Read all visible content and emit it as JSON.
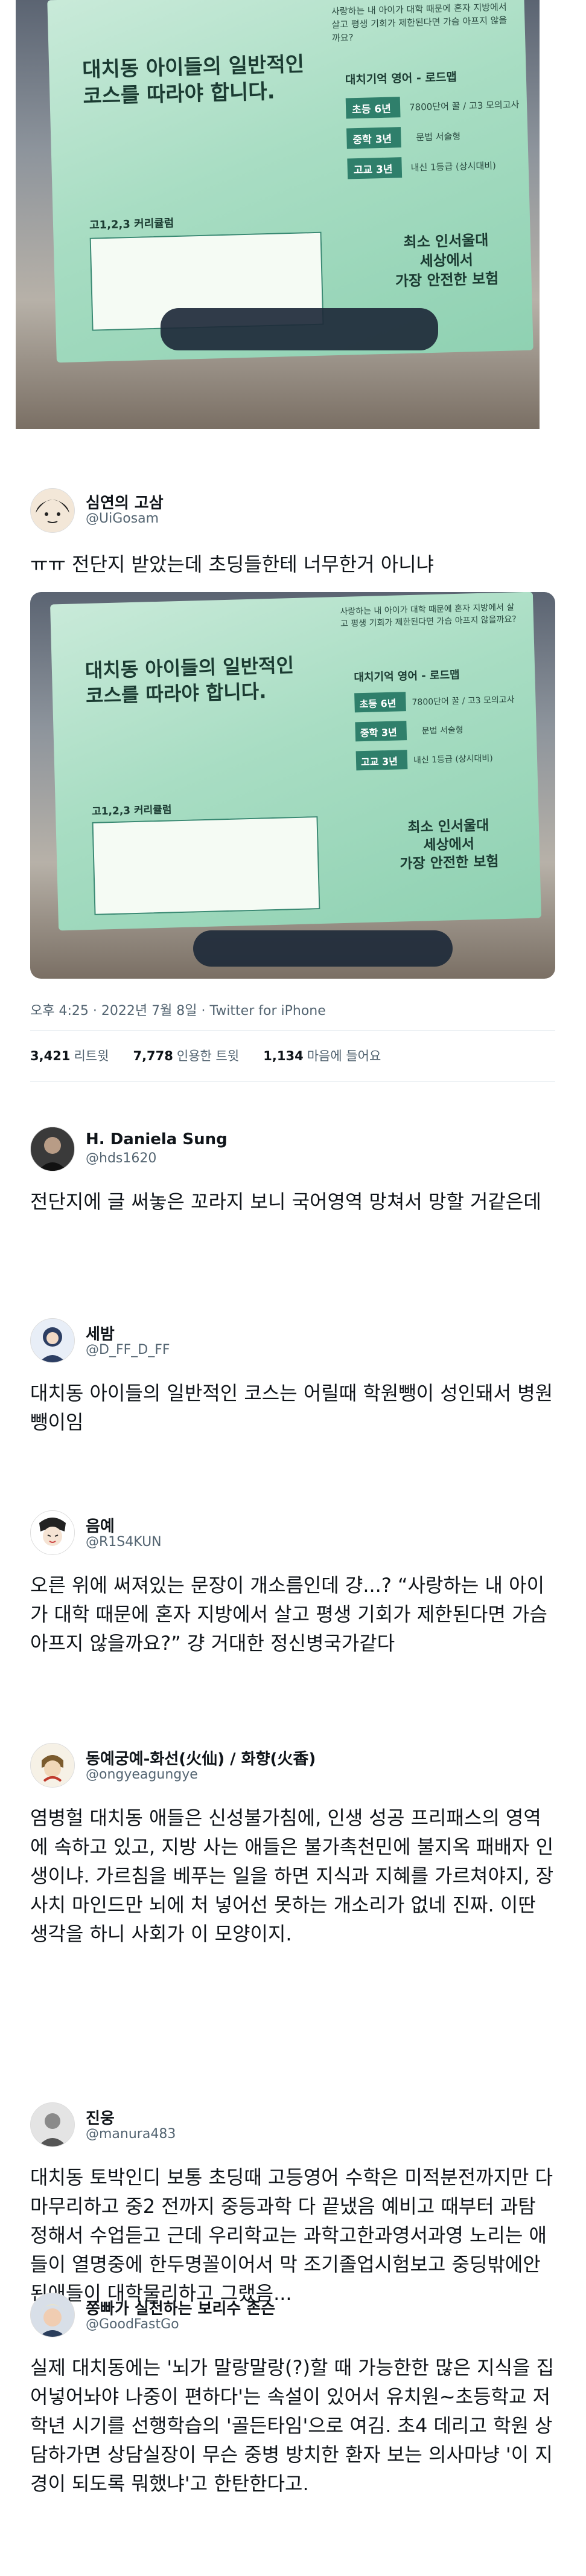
{
  "flyer": {
    "heading": "대치동 아이들의 일반적인\n코스를 따라야 합니다.",
    "roadmap_title": "대치기억 영어 - 로드맵",
    "rows": [
      "초등 6년",
      "중학 3년",
      "고교 3년"
    ],
    "row_values": [
      "7800단어 꿀 / 고3 모의고사",
      "문법 서술형",
      "내신 1등급 (상시대비)"
    ],
    "curriculum_title": "고1,2,3 커리큘럼",
    "slogan": "최소 인서울대\n세상에서\n가장 안전한 보험",
    "top_caption": "사랑하는 내 아이가 대학 때문에 혼자 지방에서 살고 평생 기회가 제한된다면 가슴 아프지 않을까요?"
  },
  "quoted": {
    "name": "심연의 고삼",
    "handle": "@UiGosam",
    "text": "ㅠㅠ 전단지 받았는데 초딩들한테 너무한거 아니냐",
    "time": "오후 4:25 · 2022년 7월 8일 · Twitter for iPhone",
    "retweets_n": "3,421",
    "retweets_l": "리트윗",
    "quotes_n": "7,778",
    "quotes_l": "인용한 트윗",
    "likes_n": "1,134",
    "likes_l": "마음에 들어요"
  },
  "replies": [
    {
      "name": "H. Daniela Sung",
      "handle": "@hds1620",
      "text": "전단지에 글 써놓은 꼬라지 보니 국어영역 망쳐서 망할 거같은데"
    },
    {
      "name": "세밤",
      "handle": "@D_FF_D_FF",
      "text": "대치동 아이들의 일반적인 코스는 어릴때 학원뺑이 성인돼서 병원뺑이임"
    },
    {
      "name": "음예",
      "handle": "@R1S4KUN",
      "text": "오른 위에 써져있는 문장이 개소름인데 걍...? “사랑하는 내 아이가 대학 때문에 혼자 지방에서 살고 평생 기회가 제한된다면 가슴 아프지 않을까요?” 걍 거대한 정신병국가같다"
    },
    {
      "name": "동예궁예-화선(火仙) / 화향(火香)",
      "handle": "@ongyeagungye",
      "text": "염병헐 대치동 애들은 신성불가침에, 인생 성공 프리패스의 영역에 속하고 있고, 지방 사는 애들은 불가촉천민에 불지옥 패배자 인생이냐. 가르침을 베푸는 일을 하면 지식과 지혜를 가르쳐야지, 장사치 마인드만 뇌에 처 넣어선 못하는 개소리가 없네 진짜. 이딴 생각을 하니 사회가 이 모양이지."
    },
    {
      "name": "진웅",
      "handle": "@manura483",
      "text": "대치동 토박인디 보통 초딩때 고등영어 수학은 미적분전까지만 다 마무리하고 중2 전까지 중등과학 다 끝냈음 예비고 때부터 과탐 정해서 수업듣고 근데 우리학교는 과학고한과영서과영 노리는 애들이 열명중에 한두명꼴이어서 막 조기졸업시험보고 중딩밖에안된애들이 대학물리하고 그랬음..."
    },
    {
      "name": "쫑빠가 실천하는 보리수 존슨",
      "handle": "@GoodFastGo",
      "text": "실제 대치동에는 '뇌가 말랑말랑(?)할 때 가능한한 많은 지식을 집어넣어놔야 나중이 편하다'는 속설이 있어서 유치원~초등학교 저학년 시기를 선행학습의 '골든타임'으로 여김. 초4 데리고 학원 상담하가면 상담실장이 무슨 중병 방치한 환자 보는 의사마냥 '이 지경이 되도록 뭐했냐'고 한탄한다고."
    }
  ],
  "colors": {
    "text": "#0f1419",
    "muted": "#536471",
    "divider": "#e6ecf0",
    "flyer": "#a8ddc3"
  }
}
